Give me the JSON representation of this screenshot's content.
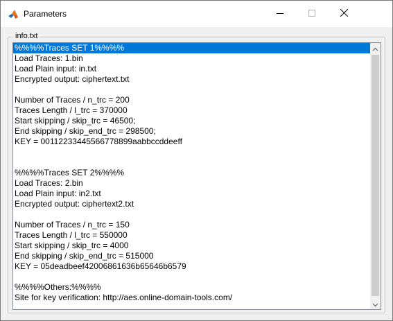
{
  "window": {
    "title": "Parameters",
    "app_icon": "matlab-icon"
  },
  "controls": {
    "minimize_icon": "minimize-icon",
    "maximize_icon": "maximize-icon",
    "close_icon": "close-icon"
  },
  "group": {
    "label": "info.txt"
  },
  "listbox": {
    "selected_index": 0,
    "items": [
      "%%%%Traces SET 1%%%%",
      "Load Traces: 1.bin",
      "Load Plain input: in.txt",
      "Encrypted output: ciphertext.txt",
      "",
      "Number of Traces / n_trc = 200",
      "Traces Length / l_trc = 370000",
      "Start skipping / skip_trc = 46500;",
      "End skipping / skip_end_trc = 298500;",
      "KEY = 00112233445566778899aabbccddeeff",
      "",
      "",
      "%%%%Traces SET 2%%%%",
      "Load Traces: 2.bin",
      "Load Plain input: in2.txt",
      "Encrypted output: ciphertext2.txt",
      "",
      "Number of Traces / n_trc = 150",
      "Traces Length / l_trc = 550000",
      "Start skipping / skip_trc = 4000",
      "End skipping / skip_end_trc = 515000",
      "KEY = 05deadbeef42006861636b65646b6579",
      "",
      "%%%%Others:%%%%",
      "Site for key verification: http://aes.online-domain-tools.com/"
    ]
  },
  "colors": {
    "selection": "#0078d7",
    "title_bar": "#ffffff",
    "dialog_bg": "#f0f0f0"
  }
}
